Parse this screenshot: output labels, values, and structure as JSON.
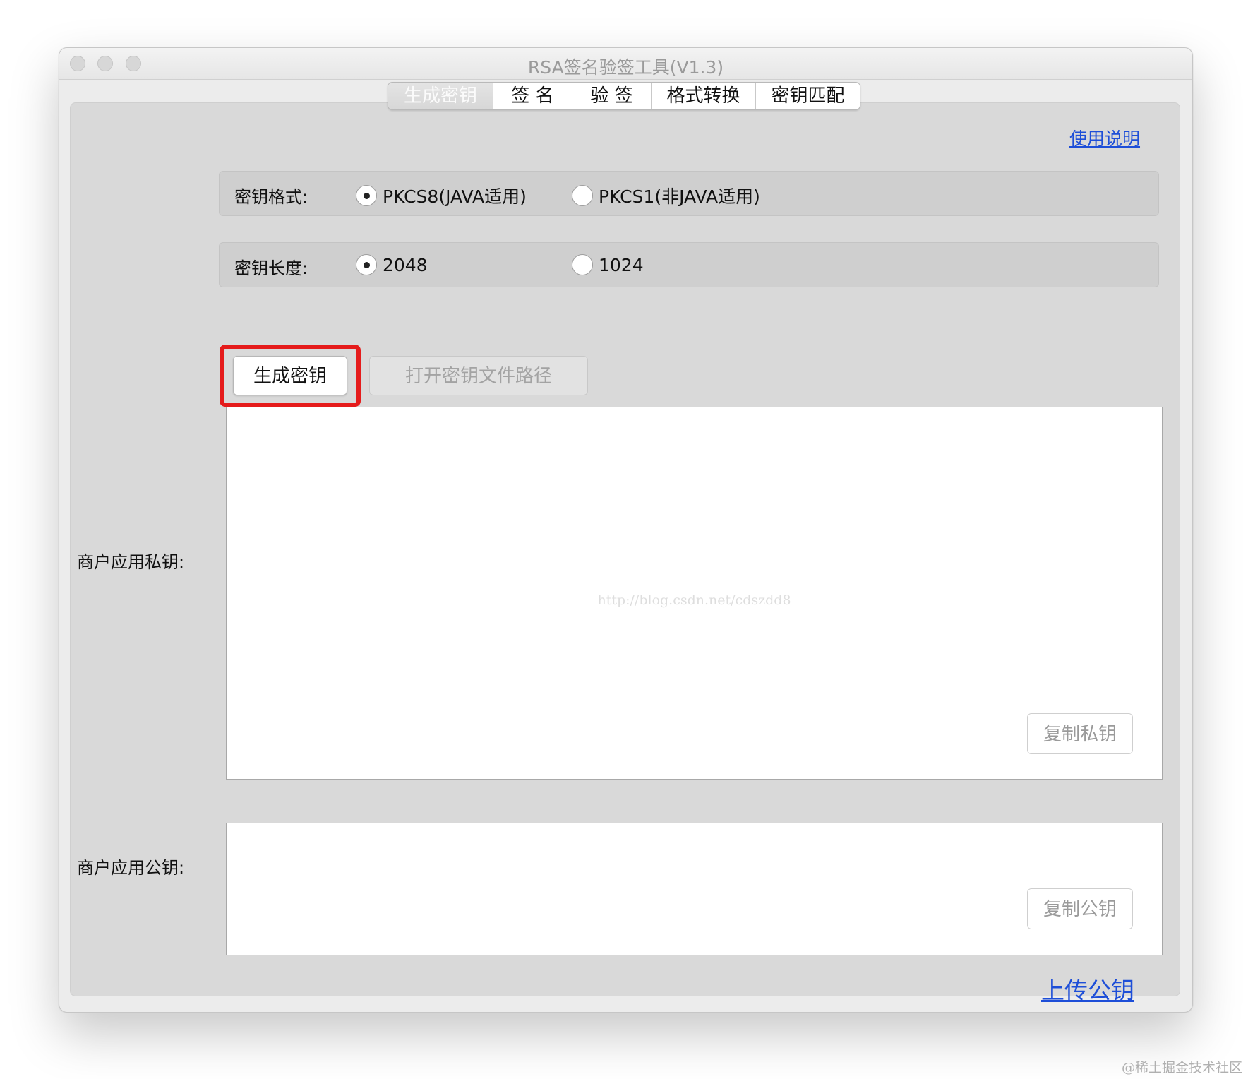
{
  "window": {
    "title": "RSA签名验签工具(V1.3)"
  },
  "tabs": [
    {
      "label": "生成密钥",
      "active": true
    },
    {
      "label": "签 名",
      "active": false
    },
    {
      "label": "验 签",
      "active": false
    },
    {
      "label": "格式转换",
      "active": false
    },
    {
      "label": "密钥匹配",
      "active": false
    }
  ],
  "help_link": "使用说明",
  "key_format": {
    "label": "密钥格式:",
    "options": [
      {
        "label": "PKCS8(JAVA适用)",
        "checked": true
      },
      {
        "label": "PKCS1(非JAVA适用)",
        "checked": false
      }
    ]
  },
  "key_length": {
    "label": "密钥长度:",
    "options": [
      {
        "label": "2048",
        "checked": true
      },
      {
        "label": "1024",
        "checked": false
      }
    ]
  },
  "buttons": {
    "generate": "生成密钥",
    "open_path": "打开密钥文件路径",
    "copy_private": "复制私钥",
    "copy_public": "复制公钥"
  },
  "private_key": {
    "label": "商户应用私钥:",
    "watermark": "http://blog.csdn.net/cdszdd8"
  },
  "public_key": {
    "label": "商户应用公钥:"
  },
  "upload_link": "上传公钥",
  "credit": "@稀土掘金技术社区",
  "colors": {
    "highlight": "#e51b1b",
    "link": "#1d4ed8"
  }
}
